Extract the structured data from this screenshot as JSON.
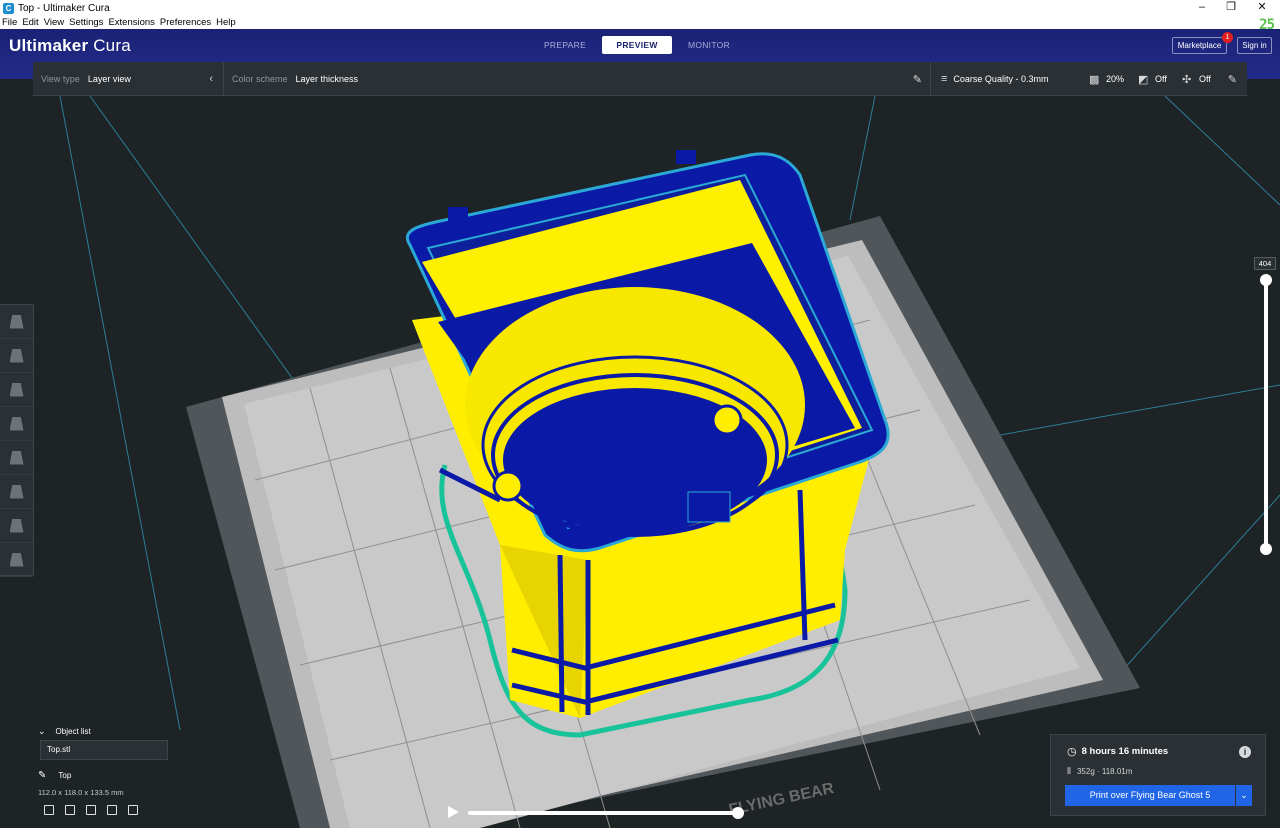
{
  "window": {
    "title": "Top - Ultimaker Cura",
    "app_icon": "C",
    "controls": [
      "–",
      "❐",
      "✕"
    ],
    "corner_badge": "25"
  },
  "menu": [
    "File",
    "Edit",
    "View",
    "Settings",
    "Extensions",
    "Preferences",
    "Help"
  ],
  "header": {
    "brand_bold": "Ultimaker",
    "brand_light": " Cura",
    "tabs": [
      {
        "label": "PREPARE",
        "active": false
      },
      {
        "label": "PREVIEW",
        "active": true
      },
      {
        "label": "MONITOR",
        "active": false
      }
    ],
    "marketplace_label": "Marketplace",
    "marketplace_badge": "1",
    "signin_label": "Sign in"
  },
  "toolbar": {
    "view_type_label": "View type",
    "view_type_value": "Layer view",
    "color_scheme_label": "Color scheme",
    "color_scheme_value": "Layer thickness",
    "quality": "Coarse Quality - 0.3mm",
    "infill": "20%",
    "support": "Off",
    "adhesion": "Off"
  },
  "layer_slider": {
    "value": "404",
    "fraction": 1.0
  },
  "object_list": {
    "header": "Object list",
    "file": "Top.stl",
    "object_name": "Top",
    "dimensions": "112.0 x 118.0 x 133.5 mm"
  },
  "print_panel": {
    "time": "8 hours 16 minutes",
    "material": "352g · 118.01m",
    "print_button": "Print over Flying Bear Ghost 5"
  },
  "plate_logo": "FLYING BEAR",
  "timeline": {
    "fraction": 1.0
  },
  "colors": {
    "header_bg": "#1a2276",
    "panel_bg": "#2b3034",
    "viewport_bg": "#1e2326",
    "print_button": "#1f65e5",
    "model_yellow": "#ffee00",
    "model_blue": "#0b1aa6",
    "skirt_green": "#18c39a"
  }
}
